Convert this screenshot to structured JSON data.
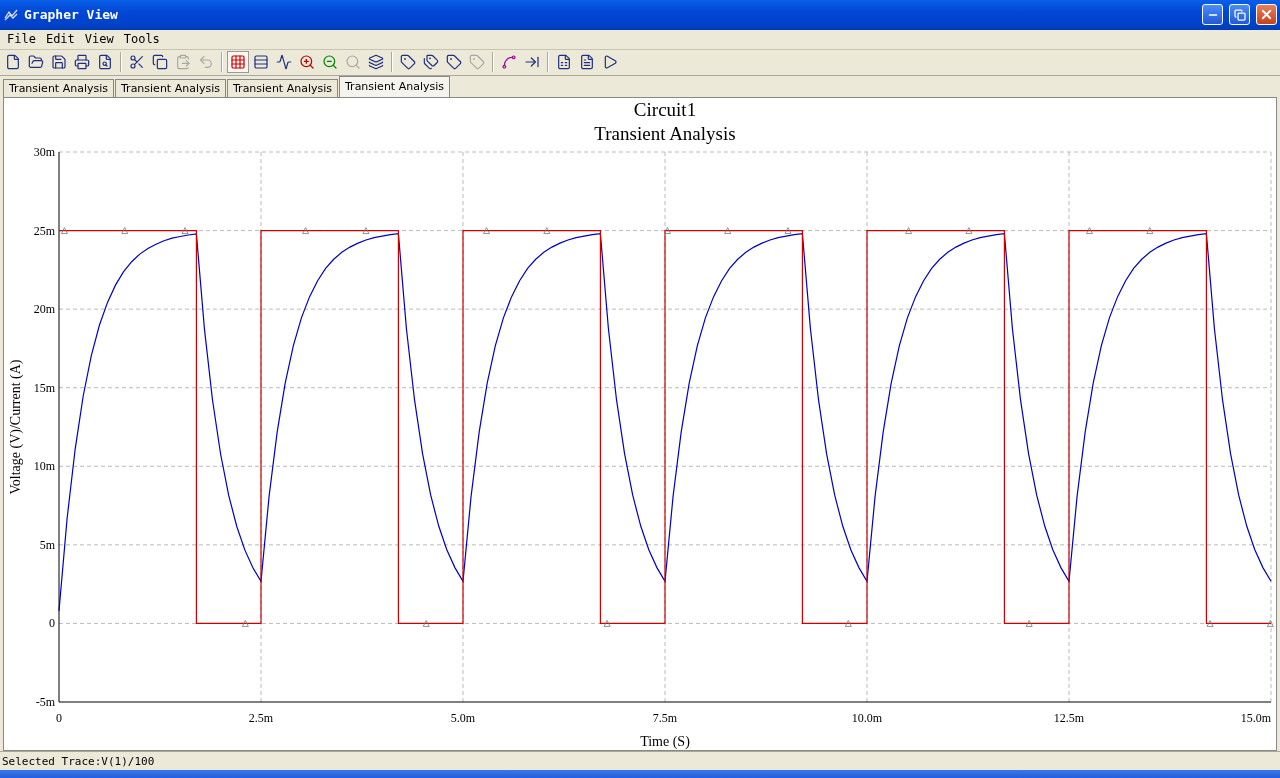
{
  "window": {
    "title": "Grapher View"
  },
  "menu": [
    "File",
    "Edit",
    "View",
    "Tools"
  ],
  "toolbar": [
    {
      "kind": "button",
      "disabled": false,
      "pressed": false
    },
    {
      "kind": "button",
      "disabled": false,
      "pressed": false
    },
    {
      "kind": "button",
      "disabled": false,
      "pressed": false
    },
    {
      "kind": "button",
      "disabled": false,
      "pressed": false
    },
    {
      "kind": "button",
      "disabled": false,
      "pressed": false
    },
    {
      "kind": "separator"
    },
    {
      "kind": "button",
      "disabled": false,
      "pressed": false
    },
    {
      "kind": "button",
      "disabled": false,
      "pressed": false
    },
    {
      "kind": "button",
      "disabled": true,
      "pressed": false
    },
    {
      "kind": "button",
      "disabled": true,
      "pressed": false
    },
    {
      "kind": "separator"
    },
    {
      "kind": "button",
      "disabled": false,
      "pressed": true
    },
    {
      "kind": "button",
      "disabled": false,
      "pressed": false
    },
    {
      "kind": "button",
      "disabled": false,
      "pressed": false
    },
    {
      "kind": "button",
      "disabled": false,
      "pressed": false
    },
    {
      "kind": "button",
      "disabled": false,
      "pressed": false
    },
    {
      "kind": "button",
      "disabled": true,
      "pressed": false
    },
    {
      "kind": "button",
      "disabled": false,
      "pressed": false
    },
    {
      "kind": "separator"
    },
    {
      "kind": "button",
      "disabled": false,
      "pressed": false
    },
    {
      "kind": "button",
      "disabled": false,
      "pressed": false
    },
    {
      "kind": "button",
      "disabled": false,
      "pressed": false
    },
    {
      "kind": "button",
      "disabled": true,
      "pressed": false
    },
    {
      "kind": "separator"
    },
    {
      "kind": "button",
      "disabled": false,
      "pressed": false
    },
    {
      "kind": "button",
      "disabled": false,
      "pressed": false
    },
    {
      "kind": "separator"
    },
    {
      "kind": "button",
      "disabled": false,
      "pressed": false
    },
    {
      "kind": "button",
      "disabled": false,
      "pressed": false
    },
    {
      "kind": "button",
      "disabled": false,
      "pressed": false
    }
  ],
  "tabs": [
    {
      "label": "Transient Analysis",
      "selected": false
    },
    {
      "label": "Transient Analysis",
      "selected": false
    },
    {
      "label": "Transient Analysis",
      "selected": false
    },
    {
      "label": "Transient Analysis",
      "selected": true
    }
  ],
  "graph": {
    "chart_data": {
      "type": "line",
      "title": "Circuit1\nTransient Analysis",
      "xlabel": "Time (S)",
      "ylabel": "Voltage (V)/Current (A)",
      "grid": true,
      "xlim": [
        0,
        15
      ],
      "ylim": [
        -5,
        30
      ],
      "xticks": [
        {
          "value": 0,
          "label": "0"
        },
        {
          "value": 2.5,
          "label": "2.5m"
        },
        {
          "value": 5,
          "label": "5.0m"
        },
        {
          "value": 7.5,
          "label": "7.5m"
        },
        {
          "value": 10,
          "label": "10.0m"
        },
        {
          "value": 12.5,
          "label": "12.5m"
        },
        {
          "value": 15,
          "label": "15.0m"
        }
      ],
      "yticks": [
        {
          "value": -5,
          "label": "-5m"
        },
        {
          "value": 0,
          "label": "0"
        },
        {
          "value": 5,
          "label": "5m"
        },
        {
          "value": 10,
          "label": "10m"
        },
        {
          "value": 15,
          "label": "15m"
        },
        {
          "value": 20,
          "label": "20m"
        },
        {
          "value": 25,
          "label": "25m"
        },
        {
          "value": 30,
          "label": "30m"
        }
      ],
      "x": [
        0,
        0.1,
        0.2,
        0.3,
        0.4,
        0.5,
        0.6,
        0.7,
        0.8,
        0.9,
        1,
        1.1,
        1.2,
        1.3,
        1.4,
        1.5,
        1.6,
        1.7,
        1.7,
        1.8,
        1.9,
        2,
        2.1,
        2.2,
        2.3,
        2.4,
        2.5,
        2.5,
        2.6,
        2.7,
        2.8,
        2.9,
        3,
        3.1,
        3.2,
        3.3,
        3.4,
        3.5,
        3.6,
        3.7,
        3.8,
        3.9,
        4,
        4.1,
        4.2,
        4.2,
        4.3,
        4.4,
        4.5,
        4.6,
        4.7,
        4.8,
        4.9,
        5,
        5,
        5.1,
        5.2,
        5.3,
        5.4,
        5.5,
        5.6,
        5.7,
        5.8,
        5.9,
        6,
        6.1,
        6.2,
        6.3,
        6.4,
        6.5,
        6.6,
        6.7,
        6.7,
        6.8,
        6.9,
        7,
        7.1,
        7.2,
        7.3,
        7.4,
        7.5,
        7.5,
        7.6,
        7.7,
        7.8,
        7.9,
        8,
        8.1,
        8.2,
        8.3,
        8.4,
        8.5,
        8.6,
        8.7,
        8.8,
        8.9,
        9,
        9.1,
        9.2,
        9.2,
        9.3,
        9.4,
        9.5,
        9.6,
        9.7,
        9.8,
        9.9,
        10,
        10,
        10.1,
        10.2,
        10.3,
        10.4,
        10.5,
        10.6,
        10.7,
        10.8,
        10.9,
        11,
        11.1,
        11.2,
        11.3,
        11.4,
        11.5,
        11.6,
        11.7,
        11.7,
        11.8,
        11.9,
        12,
        12.1,
        12.2,
        12.3,
        12.4,
        12.5,
        12.5,
        12.6,
        12.7,
        12.8,
        12.9,
        13,
        13.1,
        13.2,
        13.3,
        13.4,
        13.5,
        13.6,
        13.7,
        13.8,
        13.9,
        14,
        14.1,
        14.2,
        14.2,
        14.3,
        14.4,
        14.5,
        14.6,
        14.7,
        14.8,
        14.9,
        15
      ],
      "series": [
        {
          "color": "#cc0000",
          "values": [
            25,
            25,
            25,
            25,
            25,
            25,
            25,
            25,
            25,
            25,
            25,
            25,
            25,
            25,
            25,
            25,
            25,
            25,
            0,
            0,
            0,
            0,
            0,
            0,
            0,
            0,
            0,
            25,
            25,
            25,
            25,
            25,
            25,
            25,
            25,
            25,
            25,
            25,
            25,
            25,
            25,
            25,
            25,
            25,
            25,
            0,
            0,
            0,
            0,
            0,
            0,
            0,
            0,
            0,
            25,
            25,
            25,
            25,
            25,
            25,
            25,
            25,
            25,
            25,
            25,
            25,
            25,
            25,
            25,
            25,
            25,
            25,
            0,
            0,
            0,
            0,
            0,
            0,
            0,
            0,
            0,
            25,
            25,
            25,
            25,
            25,
            25,
            25,
            25,
            25,
            25,
            25,
            25,
            25,
            25,
            25,
            25,
            25,
            25,
            0,
            0,
            0,
            0,
            0,
            0,
            0,
            0,
            0,
            25,
            25,
            25,
            25,
            25,
            25,
            25,
            25,
            25,
            25,
            25,
            25,
            25,
            25,
            25,
            25,
            25,
            25,
            0,
            0,
            0,
            0,
            0,
            0,
            0,
            0,
            0,
            25,
            25,
            25,
            25,
            25,
            25,
            25,
            25,
            25,
            25,
            25,
            25,
            25,
            25,
            25,
            25,
            25,
            25,
            0,
            0,
            0,
            0,
            0,
            0,
            0,
            0,
            0
          ]
        },
        {
          "color": "#0000c0",
          "values": [
            0.8,
            6.68,
            11.11,
            14.47,
            17.04,
            18.97,
            20.43,
            21.54,
            22.39,
            23.02,
            23.5,
            23.86,
            24.13,
            24.35,
            24.52,
            24.62,
            24.72,
            24.78,
            24.78,
            18.76,
            14.22,
            10.78,
            8.15,
            6.17,
            4.68,
            3.54,
            2.68,
            2.68,
            8.1,
            12.19,
            15.29,
            17.66,
            19.44,
            20.78,
            21.81,
            22.59,
            23.17,
            23.62,
            23.95,
            24.2,
            24.4,
            24.55,
            24.65,
            24.74,
            24.8,
            24.8,
            18.77,
            14.24,
            10.79,
            8.16,
            6.18,
            4.69,
            3.55,
            2.68,
            2.68,
            8.1,
            12.19,
            15.29,
            17.66,
            19.44,
            20.78,
            21.81,
            22.59,
            23.17,
            23.62,
            23.95,
            24.2,
            24.4,
            24.55,
            24.65,
            24.74,
            24.8,
            24.8,
            18.77,
            14.24,
            10.79,
            8.16,
            6.18,
            4.69,
            3.55,
            2.68,
            2.68,
            8.1,
            12.19,
            15.29,
            17.66,
            19.44,
            20.78,
            21.81,
            22.59,
            23.17,
            23.62,
            23.95,
            24.2,
            24.4,
            24.55,
            24.65,
            24.74,
            24.8,
            24.8,
            18.77,
            14.24,
            10.79,
            8.16,
            6.18,
            4.69,
            3.55,
            2.68,
            2.68,
            8.1,
            12.19,
            15.29,
            17.66,
            19.44,
            20.78,
            21.81,
            22.59,
            23.17,
            23.62,
            23.95,
            24.2,
            24.4,
            24.55,
            24.65,
            24.74,
            24.8,
            24.8,
            18.77,
            14.24,
            10.79,
            8.16,
            6.18,
            4.69,
            3.55,
            2.68,
            2.68,
            8.1,
            12.19,
            15.29,
            17.66,
            19.44,
            20.78,
            21.81,
            22.59,
            23.17,
            23.62,
            23.95,
            24.2,
            24.4,
            24.55,
            24.65,
            24.74,
            24.8,
            24.8,
            18.77,
            14.24,
            10.79,
            8.16,
            6.18,
            4.69,
            3.55,
            2.68
          ]
        }
      ]
    }
  },
  "status_bar": "Selected Trace:V(1)/100"
}
